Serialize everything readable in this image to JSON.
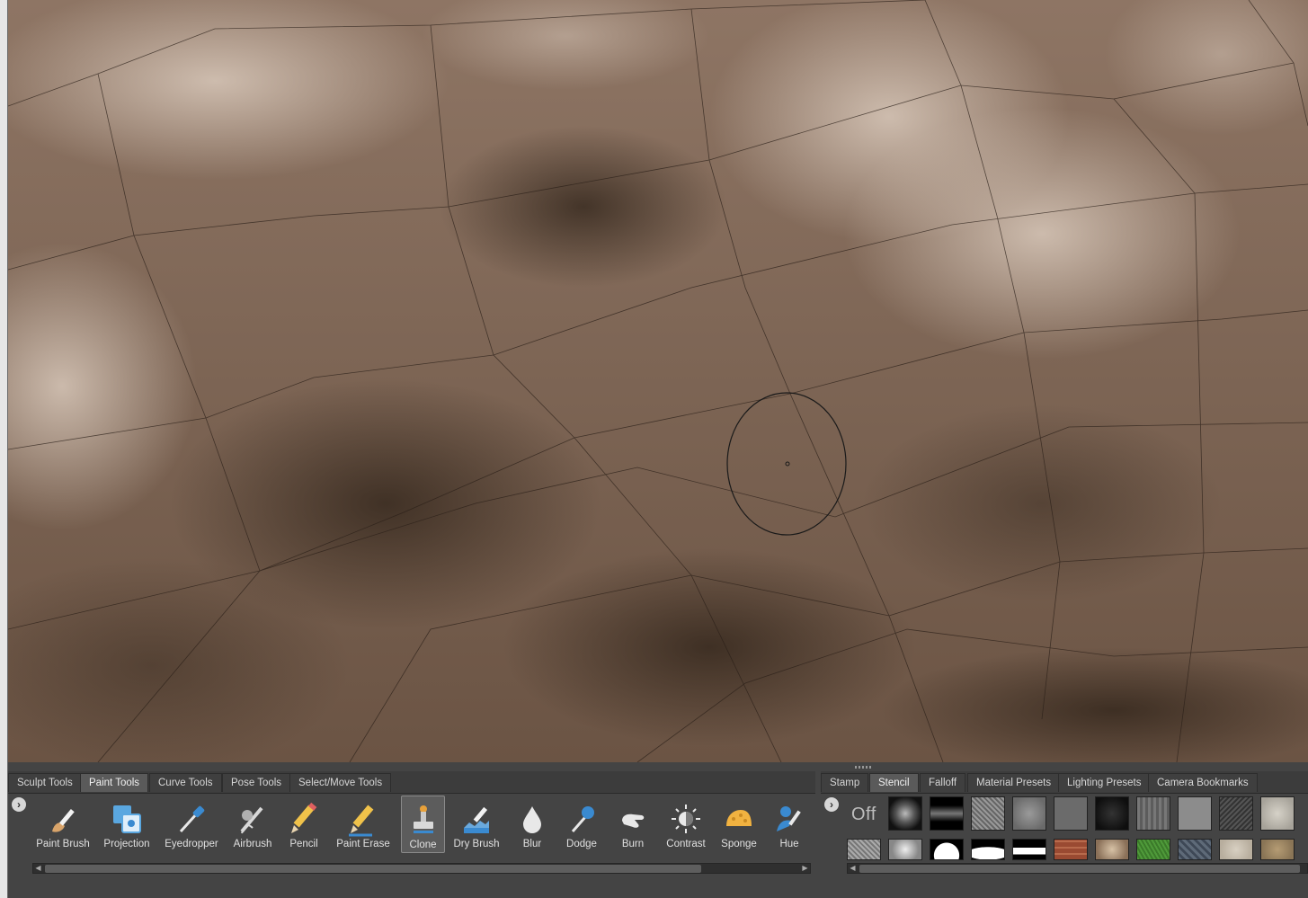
{
  "tools_panel": {
    "tabs": [
      {
        "label": "Sculpt Tools",
        "active": false
      },
      {
        "label": "Paint Tools",
        "active": true
      },
      {
        "label": "Curve Tools",
        "active": false
      },
      {
        "label": "Pose Tools",
        "active": false
      },
      {
        "label": "Select/Move Tools",
        "active": false
      }
    ],
    "tools": [
      {
        "label": "Paint Brush",
        "icon": "paint-brush-icon",
        "active": false
      },
      {
        "label": "Projection",
        "icon": "projection-icon",
        "active": false
      },
      {
        "label": "Eyedropper",
        "icon": "eyedropper-icon",
        "active": false
      },
      {
        "label": "Airbrush",
        "icon": "airbrush-icon",
        "active": false
      },
      {
        "label": "Pencil",
        "icon": "pencil-icon",
        "active": false
      },
      {
        "label": "Paint Erase",
        "icon": "paint-erase-icon",
        "active": false
      },
      {
        "label": "Clone",
        "icon": "clone-stamp-icon",
        "active": true
      },
      {
        "label": "Dry Brush",
        "icon": "dry-brush-icon",
        "active": false
      },
      {
        "label": "Blur",
        "icon": "blur-drop-icon",
        "active": false
      },
      {
        "label": "Dodge",
        "icon": "dodge-icon",
        "active": false
      },
      {
        "label": "Burn",
        "icon": "burn-hand-icon",
        "active": false
      },
      {
        "label": "Contrast",
        "icon": "contrast-sun-icon",
        "active": false
      },
      {
        "label": "Sponge",
        "icon": "sponge-icon",
        "active": false
      },
      {
        "label": "Hue",
        "icon": "hue-icon",
        "active": false
      }
    ]
  },
  "presets_panel": {
    "tabs": [
      {
        "label": "Stamp",
        "active": false
      },
      {
        "label": "Stencil",
        "active": true
      },
      {
        "label": "Falloff",
        "active": false
      },
      {
        "label": "Material Presets",
        "active": false
      },
      {
        "label": "Lighting Presets",
        "active": false
      },
      {
        "label": "Camera Bookmarks",
        "active": false
      }
    ],
    "off_label": "Off"
  },
  "colors": {
    "viewport_base": "#7e6655",
    "panel_bg": "#444444",
    "active_tab": "#5a5a5a",
    "brush_cursor": "#1a1a1a"
  }
}
